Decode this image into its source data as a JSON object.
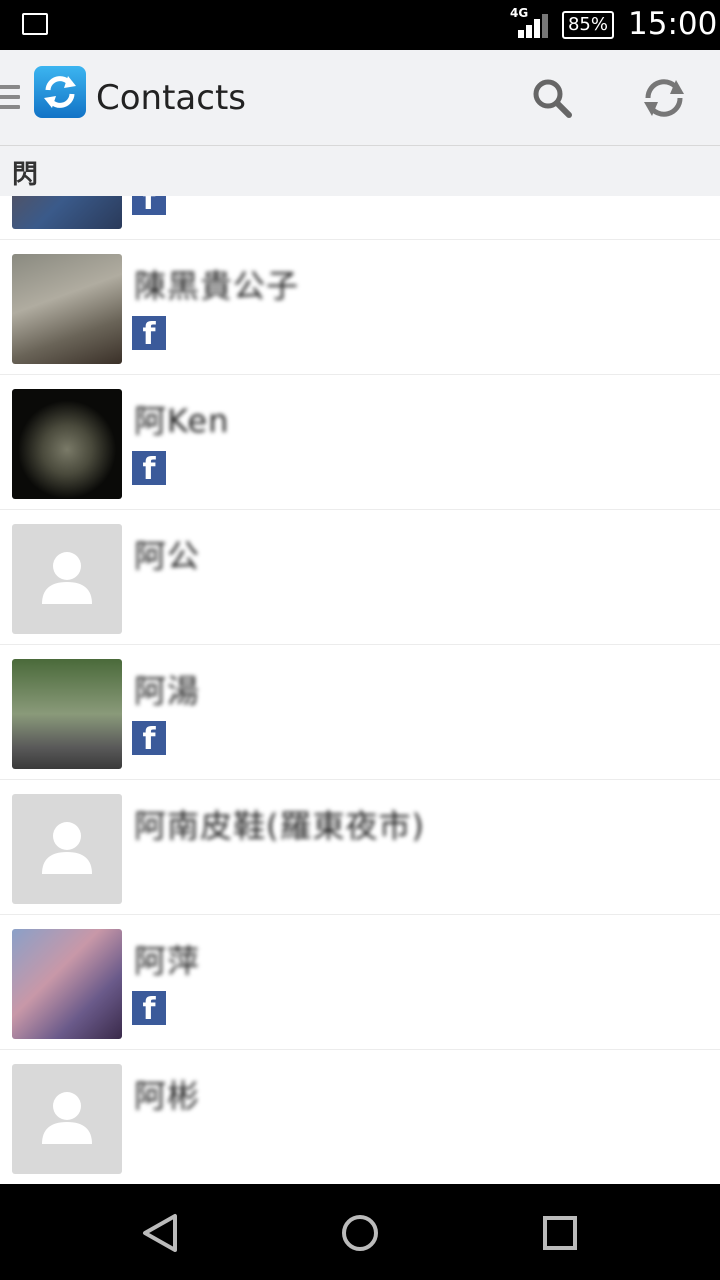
{
  "status_bar": {
    "network": "4G",
    "battery": "85%",
    "time": "15:00"
  },
  "app_bar": {
    "title": "Contacts",
    "icons": [
      "menu-icon",
      "app-logo-icon",
      "search-icon",
      "sync-icon"
    ]
  },
  "section": {
    "header": "閃"
  },
  "contacts": [
    {
      "name": "",
      "has_facebook": true,
      "avatar": "photo"
    },
    {
      "name": "陳黑貴公子",
      "has_facebook": true,
      "avatar": "cats-photo"
    },
    {
      "name": "阿Ken",
      "has_facebook": true,
      "avatar": "basket-photo"
    },
    {
      "name": "阿公",
      "has_facebook": false,
      "avatar": "placeholder"
    },
    {
      "name": "阿湯",
      "has_facebook": true,
      "avatar": "motorcycle-photo"
    },
    {
      "name": "阿南皮鞋(羅東夜市)",
      "has_facebook": false,
      "avatar": "placeholder"
    },
    {
      "name": "阿萍",
      "has_facebook": true,
      "avatar": "group-photo"
    },
    {
      "name": "阿彬",
      "has_facebook": false,
      "avatar": "placeholder"
    }
  ],
  "fb_label": "f",
  "colors": {
    "facebook": "#3b5a9a",
    "accent": "#1a8de0",
    "placeholder": "#d9d9d9"
  }
}
